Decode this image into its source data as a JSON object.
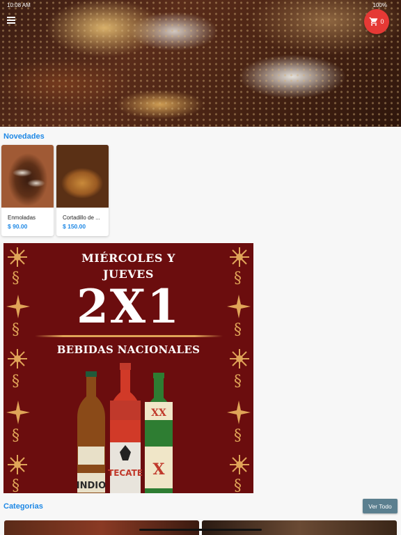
{
  "status_bar": {
    "time": "10:08 AM",
    "right": "100%"
  },
  "cart": {
    "count": "0"
  },
  "sections": {
    "novedades_title": "Novedades",
    "categorias_title": "Categorias",
    "ver_todo_label": "Ver Todo"
  },
  "products": [
    {
      "name": "Enmoladas",
      "price": "$ 90.00"
    },
    {
      "name": "Cortadillo de ...",
      "price": "$ 150.00"
    }
  ],
  "promo": {
    "line1": "MIÉRCOLES Y",
    "line2": "JUEVES",
    "headline": "2X1",
    "subtitle": "BEBIDAS NACIONALES",
    "bottle_labels": [
      "INDIO",
      "TECATE",
      "XX"
    ]
  },
  "colors": {
    "accent": "#1e88e5",
    "cart_fab": "#e53935",
    "promo_bg": "#6b0d0e",
    "promo_ornament": "#e0a458",
    "button": "#5b7f8f"
  }
}
